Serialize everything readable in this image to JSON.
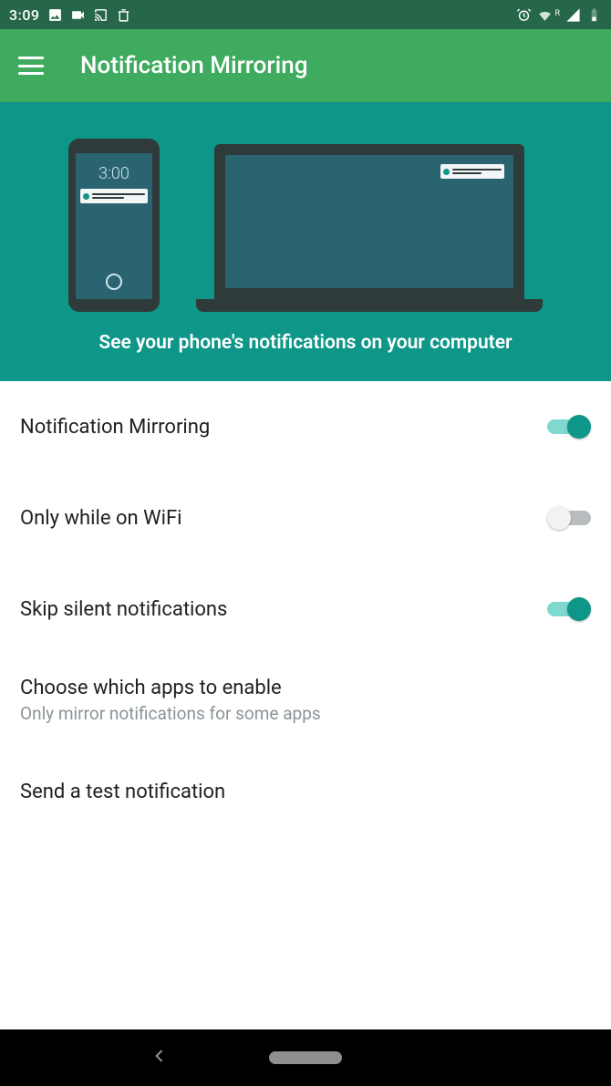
{
  "status": {
    "clock": "3:09",
    "roaming": "R"
  },
  "appbar": {
    "title": "Notification Mirroring"
  },
  "hero": {
    "phone_time": "3:00",
    "subtitle": "See your phone's notifications on your computer"
  },
  "settings": [
    {
      "title": "Notification Mirroring",
      "sub": "",
      "toggle": true,
      "on": true,
      "name": "toggle-notification-mirroring"
    },
    {
      "title": "Only while on WiFi",
      "sub": "",
      "toggle": true,
      "on": false,
      "name": "toggle-only-wifi"
    },
    {
      "title": "Skip silent notifications",
      "sub": "",
      "toggle": true,
      "on": true,
      "name": "toggle-skip-silent"
    },
    {
      "title": "Choose which apps to enable",
      "sub": "Only mirror notifications for some apps",
      "toggle": false,
      "name": "row-choose-apps"
    },
    {
      "title": "Send a test notification",
      "sub": "",
      "toggle": false,
      "name": "row-send-test"
    }
  ]
}
